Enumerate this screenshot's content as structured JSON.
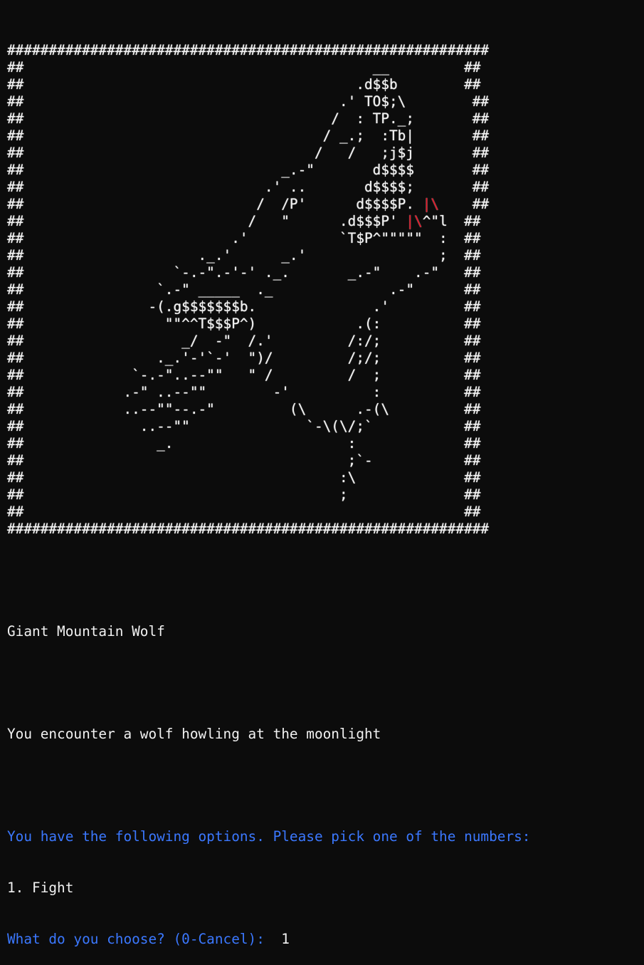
{
  "game": {
    "frame_lines": [
      "##########################################################",
      "##                                          __         ##",
      "##                                        .d$$b        ##",
      "##                                      .' TO$;\\        ##",
      "##                                     /  : TP._;       ##",
      "##                                    / _.;  :Tb|       ##",
      "##                                   /   /   ;j$j       ##",
      "##                               _.-\"       d$$$$       ##",
      "##                             .' ..       d$$$$;       ##",
      "##                            /  /P'      d$$$$P. |\\    ##",
      "##                           /   \"      .d$$$P' |\\^\"l  ##",
      "##                         .'           `T$P^\"\"\"\"\"  :  ##",
      "##                     ._.'      _.'                ;  ##",
      "##                  `-.-\".-'-' ._.       _.-\"    .-\"   ##",
      "##                `.-\" _____  ._              .-\"      ##",
      "##               -(.g$$$$$$$b.              .'         ##",
      "##                 \"\"^^T$$$P^)            .(:          ##",
      "##                   _/  -\"  /.'         /:/;          ##",
      "##                ._.'-'`-'  \")/         /;/;          ##",
      "##             `-.-\"..--\"\"   \" /         /  ;          ##",
      "##            .-\" ..--\"\"        -'          :          ##",
      "##            ..--\"\"--.-\"         (\\      .-(\\         ##",
      "##              ..--\"\"              `-\\(\\/;`           ##",
      "##                _.                     :             ##",
      "##                                       ;`-           ##",
      "##                                      :\\             ##",
      "##                                      ;              ##",
      "##                                                     ##",
      "##########################################################"
    ],
    "enemy_name": "Giant Mountain Wolf",
    "encounter_text": "You encounter a wolf howling at the moonlight",
    "options_prompt": "You have the following options. Please pick one of the numbers:",
    "options": [
      "1. Fight"
    ],
    "choice_prompt": "What do you choose? (0-Cancel):",
    "choice_input": "1"
  },
  "colors": {
    "background": "#0c0c0c",
    "text": "#f2f2f2",
    "prompt_blue": "#3b78ff",
    "eye_red": "#e81123"
  }
}
